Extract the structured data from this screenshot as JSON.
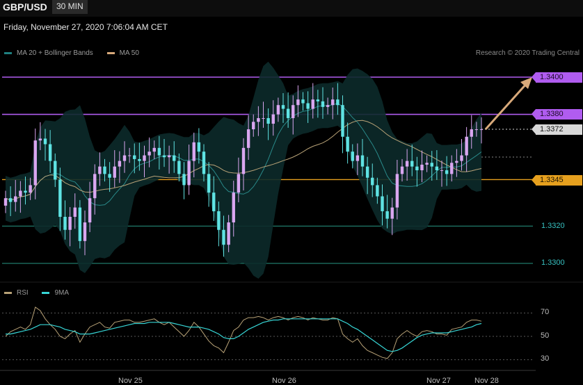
{
  "header": {
    "symbol": "GBP/USD",
    "timeframe": "30 MIN",
    "datetime": "Friday, November 27, 2020 7:06:04 AM CET",
    "copyright": "Research © 2020 Trading Central"
  },
  "legend": {
    "ma20_label": "MA 20 + Bollinger Bands",
    "ma50_label": "MA 50",
    "rsi_label": "RSI",
    "rsi_ma_label": "9MA"
  },
  "colors": {
    "background": "#000000",
    "up_candle": "#d9a6f0",
    "down_candle": "#5fe3e3",
    "bollinger_fill": "#0c2a2a",
    "ma20": "#2a8a8a",
    "ma50": "#b8a277",
    "resistance": "#b05cf0",
    "pivot": "#e6a01e",
    "support": "#1f7a6a",
    "current_price": "#d8d8d8",
    "arrow": "#d8a97a",
    "rsi": "#b8a277",
    "rsi_ma": "#37d6d6"
  },
  "levels": {
    "resistance_2": "1.3400",
    "resistance_1": "1.3380",
    "current": "1.3372",
    "pivot": "1.3345",
    "support_1": "1.3320",
    "support_2": "1.3300"
  },
  "rsi_ticks": [
    "70",
    "50",
    "30"
  ],
  "x_ticks": [
    "Nov 25",
    "Nov 26",
    "Nov 27",
    "Nov 28"
  ],
  "chart_data": [
    {
      "type": "candlestick",
      "title": "GBP/USD",
      "interval": "30 MIN",
      "ylim": [
        1.329,
        1.341
      ],
      "x_ticks": [
        "Nov 25",
        "Nov 26",
        "Nov 27",
        "Nov 28"
      ],
      "horizontal_levels": [
        1.34,
        1.338,
        1.3372,
        1.3345,
        1.332,
        1.33
      ],
      "closes": [
        1.3335,
        1.3333,
        1.3336,
        1.3339,
        1.3338,
        1.3342,
        1.3366,
        1.3367,
        1.3364,
        1.3355,
        1.3345,
        1.3325,
        1.3318,
        1.3325,
        1.333,
        1.3312,
        1.3322,
        1.3335,
        1.3348,
        1.3352,
        1.3348,
        1.3346,
        1.3352,
        1.3355,
        1.3358,
        1.3358,
        1.3356,
        1.3355,
        1.3358,
        1.336,
        1.3362,
        1.3358,
        1.3357,
        1.3358,
        1.3355,
        1.3348,
        1.3342,
        1.3355,
        1.3365,
        1.336,
        1.3348,
        1.3338,
        1.3328,
        1.3318,
        1.331,
        1.3322,
        1.3338,
        1.3348,
        1.3362,
        1.3372,
        1.3376,
        1.3378,
        1.3378,
        1.3375,
        1.338,
        1.3385,
        1.3383,
        1.3378,
        1.3385,
        1.3388,
        1.3386,
        1.3383,
        1.3388,
        1.3387,
        1.3384,
        1.3385,
        1.3388,
        1.3385,
        1.3368,
        1.336,
        1.3355,
        1.3358,
        1.3352,
        1.3346,
        1.3342,
        1.3336,
        1.3328,
        1.3324,
        1.333,
        1.3348,
        1.3352,
        1.3355,
        1.3352,
        1.335,
        1.3353,
        1.3354,
        1.3352,
        1.335,
        1.335,
        1.3348,
        1.3354,
        1.3355,
        1.3358,
        1.3368,
        1.3372,
        1.3372,
        1.3372
      ],
      "rsi": {
        "ylim": [
          25,
          80
        ],
        "ticks": [
          70,
          50,
          30
        ],
        "rsi_values": [
          50,
          54,
          56,
          58,
          56,
          60,
          75,
          72,
          65,
          60,
          56,
          50,
          48,
          52,
          55,
          45,
          52,
          58,
          60,
          62,
          58,
          57,
          62,
          63,
          64,
          64,
          62,
          62,
          63,
          64,
          65,
          62,
          60,
          62,
          58,
          54,
          50,
          55,
          62,
          58,
          52,
          46,
          42,
          40,
          36,
          45,
          55,
          58,
          64,
          66,
          66,
          67,
          66,
          64,
          66,
          67,
          66,
          64,
          66,
          67,
          66,
          64,
          66,
          65,
          64,
          64,
          66,
          65,
          52,
          48,
          45,
          48,
          42,
          38,
          36,
          34,
          32,
          31,
          36,
          48,
          52,
          55,
          52,
          50,
          54,
          55,
          54,
          52,
          52,
          51,
          56,
          57,
          58,
          62,
          64,
          64,
          63
        ],
        "ma_values": [
          52,
          52,
          53,
          54,
          55,
          56,
          58,
          60,
          60,
          60,
          59,
          58,
          56,
          55,
          54,
          52,
          52,
          52,
          53,
          54,
          55,
          56,
          57,
          58,
          59,
          60,
          61,
          61,
          61,
          62,
          62,
          62,
          62,
          62,
          61,
          60,
          59,
          58,
          58,
          58,
          57,
          56,
          54,
          52,
          49,
          48,
          48,
          50,
          53,
          56,
          58,
          60,
          62,
          63,
          64,
          64,
          65,
          65,
          65,
          65,
          65,
          65,
          65,
          65,
          65,
          65,
          65,
          65,
          63,
          61,
          58,
          56,
          53,
          50,
          47,
          44,
          41,
          38,
          37,
          38,
          40,
          43,
          46,
          49,
          51,
          52,
          53,
          53,
          53,
          53,
          54,
          55,
          56,
          57,
          58,
          60,
          61
        ]
      }
    }
  ]
}
